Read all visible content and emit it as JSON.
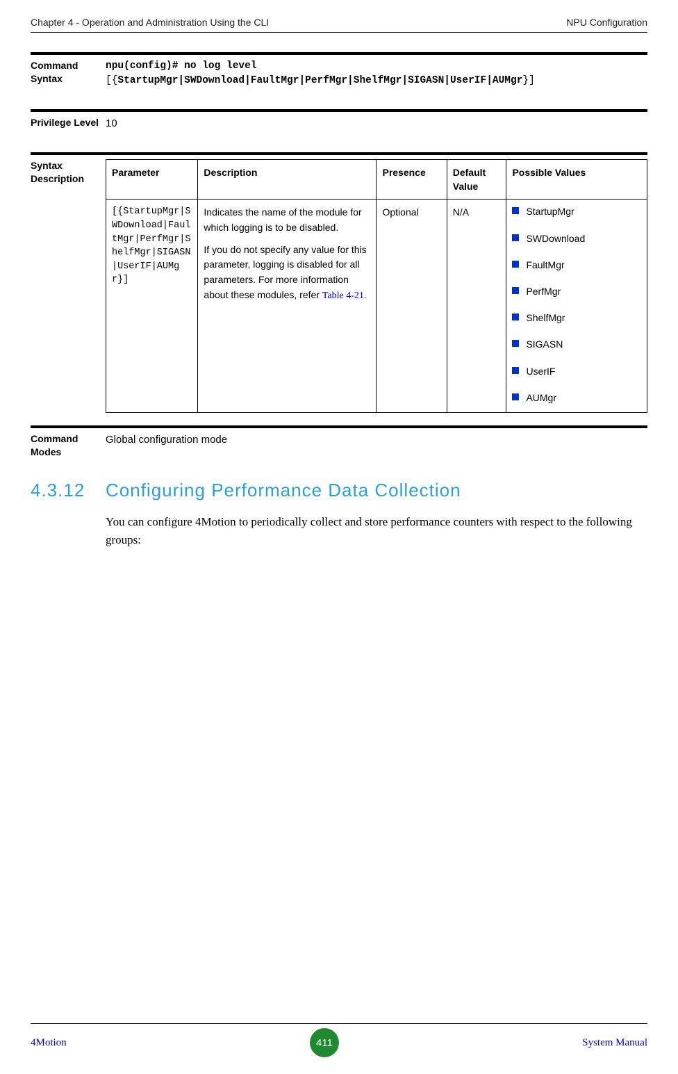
{
  "header": {
    "left": "Chapter 4 - Operation and Administration Using the CLI",
    "right": "NPU Configuration"
  },
  "command_syntax": {
    "label": "Command Syntax",
    "line1": "npu(config)# no log level",
    "line2_prefix": "[{",
    "line2_modules": "StartupMgr|SWDownload|FaultMgr|PerfMgr|ShelfMgr|SIGASN|UserIF|AUMgr",
    "line2_suffix": "}]"
  },
  "privilege": {
    "label": "Privilege Level",
    "value": "10"
  },
  "syntax_desc": {
    "label": "Syntax Description",
    "headers": {
      "param": "Parameter",
      "desc": "Description",
      "presence": "Presence",
      "default": "Default Value",
      "values": "Possible Values"
    },
    "row": {
      "param": "[{StartupMgr|SWDownload|FaultMgr|PerfMgr|ShelfMgr|SIGASN|UserIF|AUMgr}]",
      "desc_p1": "Indicates the name of the module for which logging is to be disabled.",
      "desc_p2a": "If you do not specify any value for this parameter, logging is disabled for all parameters. For more information about these modules, refer ",
      "desc_link": "Table 4-21",
      "desc_p2b": ".",
      "presence": "Optional",
      "default": "N/A",
      "values": [
        "StartupMgr",
        "SWDownload",
        "FaultMgr",
        "PerfMgr",
        "ShelfMgr",
        "SIGASN",
        "UserIF",
        "AUMgr"
      ]
    }
  },
  "command_modes": {
    "label": "Command Modes",
    "value": "Global configuration mode"
  },
  "heading": {
    "num": "4.3.12",
    "title": "Configuring Performance Data Collection"
  },
  "body_para": "You can configure 4Motion to periodically collect and store performance counters with respect to the following groups:",
  "footer": {
    "left": "4Motion",
    "page": "411",
    "right": "System Manual"
  }
}
